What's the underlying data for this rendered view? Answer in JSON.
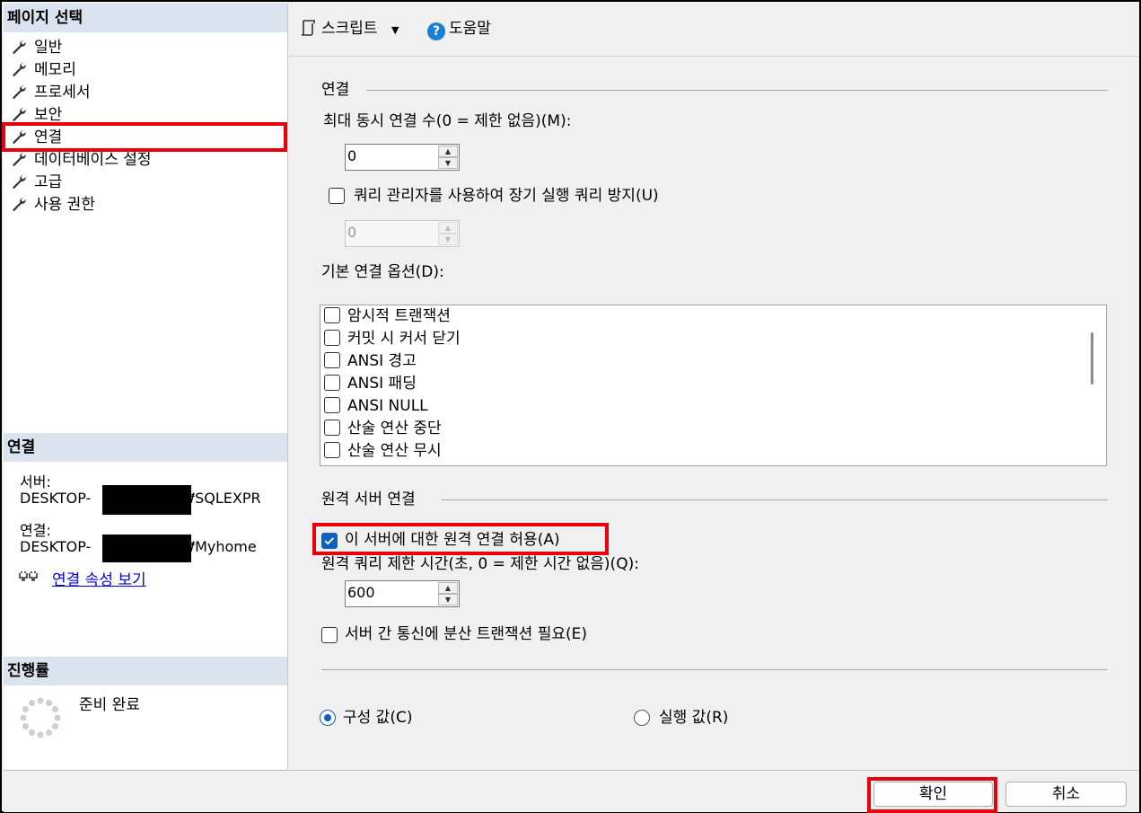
{
  "left_panel": {
    "page_select_header": "페이지 선택",
    "nav_items": [
      {
        "label": "일반",
        "icon": "wrench-icon"
      },
      {
        "label": "메모리",
        "icon": "wrench-icon"
      },
      {
        "label": "프로세서",
        "icon": "wrench-icon"
      },
      {
        "label": "보안",
        "icon": "wrench-icon"
      },
      {
        "label": "연결",
        "icon": "wrench-icon",
        "selected": true
      },
      {
        "label": "데이터베이스 설정",
        "icon": "wrench-icon"
      },
      {
        "label": "고급",
        "icon": "wrench-icon"
      },
      {
        "label": "사용 권한",
        "icon": "wrench-icon"
      }
    ],
    "connection_header": "연결",
    "server_label": "서버:",
    "server_prefix": "DESKTOP-",
    "server_suffix": "₩SQLEXPR",
    "connection_label": "연결:",
    "connection_prefix": "DESKTOP-",
    "connection_suffix": "₩Myhome",
    "view_props_link": "연결 속성 보기",
    "progress_header": "진행률",
    "progress_status": "준비 완료"
  },
  "toolbar": {
    "script_label": "스크립트",
    "help_label": "도움말"
  },
  "connection_group": {
    "title": "연결",
    "max_conn_label": "최대 동시 연결 수(0 = 제한 없음)(M):",
    "max_conn_value": "0",
    "query_governor_label": "쿼리 관리자를 사용하여 장기 실행 쿼리 방지(U)",
    "query_governor_checked": false,
    "query_governor_value": "0",
    "default_options_label": "기본 연결 옵션(D):",
    "options": [
      "암시적 트랜잭션",
      "커밋 시 커서 닫기",
      "ANSI 경고",
      "ANSI 패딩",
      "ANSI NULL",
      "산술 연산 중단",
      "산술 연산 무시"
    ]
  },
  "remote_group": {
    "title": "원격 서버 연결",
    "allow_remote_label": "이 서버에 대한 원격 연결 허용(A)",
    "allow_remote_checked": true,
    "timeout_label": "원격 쿼리 제한 시간(초, 0 = 제한 시간 없음)(Q):",
    "timeout_value": "600",
    "distributed_label": "서버 간 통신에 분산 트랜잭션 필요(E)",
    "distributed_checked": false
  },
  "radio": {
    "configured_label": "구성 값(C)",
    "running_label": "실행 값(R)",
    "selected": "configured"
  },
  "buttons": {
    "ok_label": "확인",
    "cancel_label": "취소"
  },
  "colors": {
    "highlight_red": "#e8000b",
    "accent_blue": "#1060c0",
    "header_bg": "#dbe4ee"
  }
}
